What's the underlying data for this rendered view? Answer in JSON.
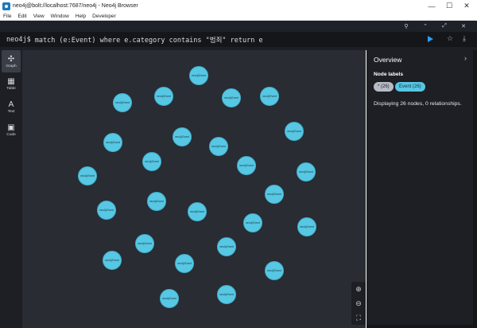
{
  "window": {
    "title": "neo4j@bolt://localhost:7687/neo4j - Neo4j Browser",
    "controls": {
      "minimize": "—",
      "maximize": "☐",
      "close": "✕"
    }
  },
  "menu": [
    "File",
    "Edit",
    "View",
    "Window",
    "Help",
    "Developer"
  ],
  "toolbar_icons": [
    "pin-icon",
    "collapse-icon",
    "expand-icon",
    "close-icon"
  ],
  "editor": {
    "prompt": "neo4j$",
    "query": "match (e:Event) where e.category contains \"범죄\" return e",
    "icons": [
      "play-icon",
      "star-icon",
      "download-icon"
    ]
  },
  "sidebar": [
    {
      "id": "graph",
      "label": "Graph",
      "icon": "graph-icon",
      "glyph": "✣",
      "active": true
    },
    {
      "id": "table",
      "label": "Table",
      "icon": "table-icon",
      "glyph": "▦",
      "active": false
    },
    {
      "id": "text",
      "label": "Text",
      "icon": "text-icon",
      "glyph": "A",
      "active": false
    },
    {
      "id": "code",
      "label": "Code",
      "icon": "code-icon",
      "glyph": "▣",
      "active": false
    }
  ],
  "graph": {
    "node_color": "#57c7e3",
    "nodes": [
      {
        "caption": "neo4j:Event"
      },
      {
        "caption": "neo4j:Event"
      },
      {
        "caption": "neo4j:Event"
      },
      {
        "caption": "neo4j:Event"
      },
      {
        "caption": "neo4j:Event"
      },
      {
        "caption": "neo4j:Event"
      },
      {
        "caption": "neo4j:Event"
      },
      {
        "caption": "neo4j:Event"
      },
      {
        "caption": "neo4j:Event"
      },
      {
        "caption": "neo4j:Event"
      },
      {
        "caption": "neo4j:Event"
      },
      {
        "caption": "neo4j:Event"
      },
      {
        "caption": "neo4j:Event"
      },
      {
        "caption": "neo4j:Event"
      },
      {
        "caption": "neo4j:Event"
      },
      {
        "caption": "neo4j:Event"
      },
      {
        "caption": "neo4j:Event"
      },
      {
        "caption": "neo4j:Event"
      },
      {
        "caption": "neo4j:Event"
      },
      {
        "caption": "neo4j:Event"
      },
      {
        "caption": "neo4j:Event"
      },
      {
        "caption": "neo4j:Event"
      },
      {
        "caption": "neo4j:Event"
      },
      {
        "caption": "neo4j:Event"
      },
      {
        "caption": "neo4j:Event"
      },
      {
        "caption": "neo4j:Event"
      }
    ]
  },
  "zoom": {
    "zoom_in": "⊕",
    "zoom_out": "⊖",
    "fit": "⛶"
  },
  "overview": {
    "title": "Overview",
    "chevron": "›",
    "section_label": "Node labels",
    "badges": [
      {
        "id": "all",
        "label": "* (26)"
      },
      {
        "id": "event",
        "label": "Event (26)"
      }
    ],
    "description": "Displaying 26 nodes, 0 relationships."
  }
}
